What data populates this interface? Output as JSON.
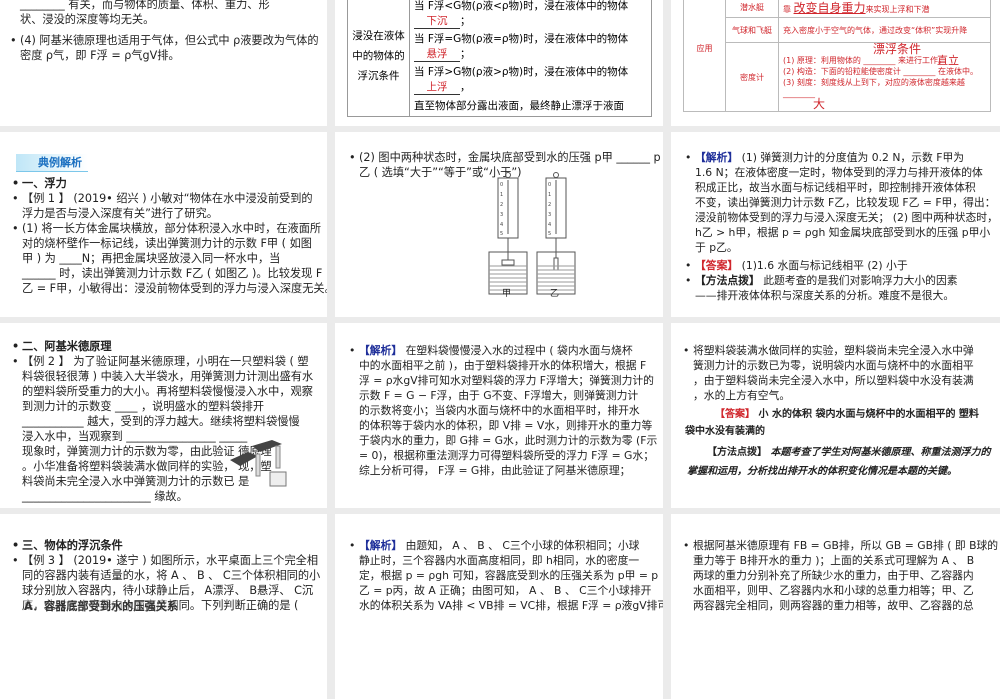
{
  "slides": [
    {
      "id": "r1c1",
      "lines": [
        "________ 有关，而与物体的质量、体积、重力、形",
        "状、浸没的深度等均无关。",
        "(4) 阿基米德原理也适用于气体，但公式中 ρ液要改为气体的",
        "密度 ρ气，即 F浮 = ρ气gV排。"
      ]
    },
    {
      "id": "r1c2",
      "row_header": [
        "浸没在液体",
        "中的物体的",
        "浮沉条件"
      ],
      "rows": [
        {
          "cond": "当 F浮<G物(ρ液<ρ物)时，浸在液体中的物体",
          "answer": "下沉",
          "end": "；"
        },
        {
          "cond": "当 F浮=G物(ρ液=ρ物)时，浸在液体中的物体",
          "answer": "悬浮",
          "end": "；"
        },
        {
          "cond": "当 F浮>G物(ρ液>ρ物)时，浸在液体中的物体",
          "answer": "上浮",
          "end": "，"
        }
      ],
      "last": "直至物体部分露出液面，最终静止漂浮于液面"
    },
    {
      "id": "r1c3",
      "category": "应用",
      "rows": [
        {
          "name": "潜水艇",
          "pre": "靠",
          "answer": "改变自身重力",
          "post": "来实现上浮和下潜"
        },
        {
          "name": "气球和飞艇",
          "text": "充入密度小于空气的气体，通过改变“体积”实现升降"
        },
        {
          "name": "密度计",
          "heading": "漂浮条件",
          "lines": [
            "(1) 原理：利用物体的 ________ 来进行工作。",
            "(2) 构造：下面的铅粒能使密度计 ________ 在液体中。",
            "(3) 刻度：刻度线从上到下，对应的液体密度越来越 ________"
          ],
          "answer1": "直立",
          "answer2": "大"
        }
      ]
    },
    {
      "id": "r2c1",
      "logo": "典例解析",
      "lines": [
        "一、浮力",
        "【例 1 】   (2019• 绍兴 ) 小敏对“物体在水中浸没前受到的",
        "浮力是否与浸入深度有关”进行了研究。",
        "(1) 将一长方体金属块横放，部分体积浸入水中时，在液面所",
        "对的烧杯壁作一标记线，读出弹簧测力计的示数 F甲 ( 如图",
        "甲 ) 为 ____N；再把金属块竖放浸入同一杯水中，当",
        "______ 时，读出弹簧测力计示数 F乙 ( 如图乙 )。比较发现 F",
        "乙 = F甲，小敏得出：浸没前物体受到的浮力与浸入深度无关。"
      ]
    },
    {
      "id": "r2c2",
      "lines": [
        "(2) 图中两种状态时，金属块底部受到水的压强 p甲 ______ p",
        "乙 ( 选填“大于”“等于”或“小于”)"
      ],
      "fig_labels": [
        "甲",
        "乙"
      ],
      "scale_ticks": [
        "0",
        "1",
        "2",
        "3",
        "4",
        "5"
      ]
    },
    {
      "id": "r2c3",
      "tag_analysis": "【解析】",
      "lines": [
        "   (1) 弹簧测力计的分度值为 0.2 N，示数 F甲为",
        "1.6 N；在液体密度一定时，物体受到的浮力与排开液体的体",
        "积成正比，故当水面与标记线相平时，即控制排开液体体积",
        "不变，读出弹簧测力计示数 F乙，比较发现 F乙 = F甲，得出：",
        "浸没前物体受到的浮力与浸入深度无关； (2) 图中两种状态时，",
        "h乙 > h甲，根据 p = ρgh 知金属块底部受到水的压强 p甲小",
        "于 p乙。"
      ],
      "tag_answer": "【答案】",
      "answer": "   (1)1.6    水面与标记线相平    (2) 小于",
      "tag_method": "【方法点拨】",
      "method": [
        "   此题考查的是我们对影响浮力大小的因素",
        "——排开液体体积与深度关系的分析。难度不是很大。"
      ]
    },
    {
      "id": "r3c1",
      "lines": [
        "二、阿基米德原理",
        "【例 2 】   为了验证阿基米德原理，小明在一只塑料袋 ( 塑",
        "料袋很轻很薄 ) 中装入大半袋水，用弹簧测力计测出盛有水",
        "的塑料袋所受重力的大小。再将塑料袋慢慢浸入水中，观察",
        "到测力计的示数变 ____ ，说明盛水的塑料袋排开",
        "___________ 越大，受到的浮力越大。继续将塑料袋慢慢",
        "浸入水中，当观察到 ________________            _____",
        "现象时，弹簧测力计的示数为零，由此验证          德原理",
        "。小华准备将塑料袋装满水做同样的实验，           现，塑",
        "料袋尚未完全浸入水中弹簧测力计的示数已           是",
        "_______________________ 缘故。"
      ]
    },
    {
      "id": "r3c2",
      "tag_analysis": "【解析】",
      "lines": [
        "   在塑料袋慢慢浸入水的过程中 ( 袋内水面与烧杯",
        "中的水面相平之前 )，由于塑料袋排开水的体积增大，根据 F",
        "浮 = ρ水gV排可知水对塑料袋的浮力 F浮增大；弹簧测力计的",
        "示数 F = G − F浮，由于 G不变、F浮增大，则弹簧测力计",
        "的示数将变小；当袋内水面与烧杯中的水面相平时，排开水",
        "的体积等于袋内水的体积，即 V排 = V水，则排开水的重力等",
        "于袋内水的重力，即 G排 = G水，此时测力计的示数为零 (F示",
        "= 0)，根据称重法测浮力可得塑料袋所受的浮力 F浮 = G水；",
        "综上分析可得， F浮 = G排，由此验证了阿基米德原理；"
      ]
    },
    {
      "id": "r3c3",
      "lines": [
        "将塑料袋装满水做同样的实验，塑料袋尚未完全浸入水中弹",
        "簧测力计的示数已为零，说明袋内水面与烧杯中的水面相平",
        "，由于塑料袋尚未完全浸入水中，所以塑料袋中水没有装满",
        "，水的上方有空气。"
      ],
      "tag_answer": "【答案】",
      "answer": "   小    水的体积    袋内水面与烧杯中的水面相平的    塑料",
      "answer2": "袋中水没有装满的",
      "tag_method": "【方法点拨】",
      "method": [
        "   本题考查了学生对阿基米德原理、称重法测浮力的",
        "掌握和运用，分析找出排开水的体积变化情况是本题的关键。"
      ]
    },
    {
      "id": "r4c1",
      "lines": [
        "三、物体的浮沉条件",
        "【例 3 】   (2019• 遂宁 ) 如图所示，水平桌面上三个完全相",
        "同的容器内装有适量的水，将 A 、 B 、 C三个体积相同的小",
        "球分别放入容器内，待小球静止后， A漂浮、 B悬浮、 C沉",
        "底，此时三个容器内水面高度相同。下列判断正确的是 ("
      ],
      "overlap": "A．容器底部受到水的压强关系"
    },
    {
      "id": "r4c2",
      "tag_analysis": "【解析】",
      "lines": [
        "   由题知， A 、 B 、 C三个小球的体积相同；小球",
        "静止时，三个容器内水面高度相同，即 h相同，水的密度一",
        "定，根据 p = ρgh 可知，容器底受到水的压强关系为 p甲 = p",
        "乙 = p丙，故 A 正确；由图可知， A 、 B 、 C三个小球排开",
        "水的体积关系为 VA排 < VB排 = VC排，根据 F浮 = ρ液gV排可知，"
      ]
    },
    {
      "id": "r4c3",
      "lines": [
        "根据阿基米德原理有 FB = GB排，所以 GB = GB排 ( 即 B球的",
        "重力等于 B排开水的重力 )；上面的关系式可理解为 A 、 B",
        "两球的重力分别补充了所缺少水的重力，由于甲、乙容器内",
        "水面相平，则甲、乙容器内水和小球的总重力相等；甲、乙",
        "两容器完全相同，则两容器的重力相等，故甲、乙容器的总"
      ]
    }
  ]
}
